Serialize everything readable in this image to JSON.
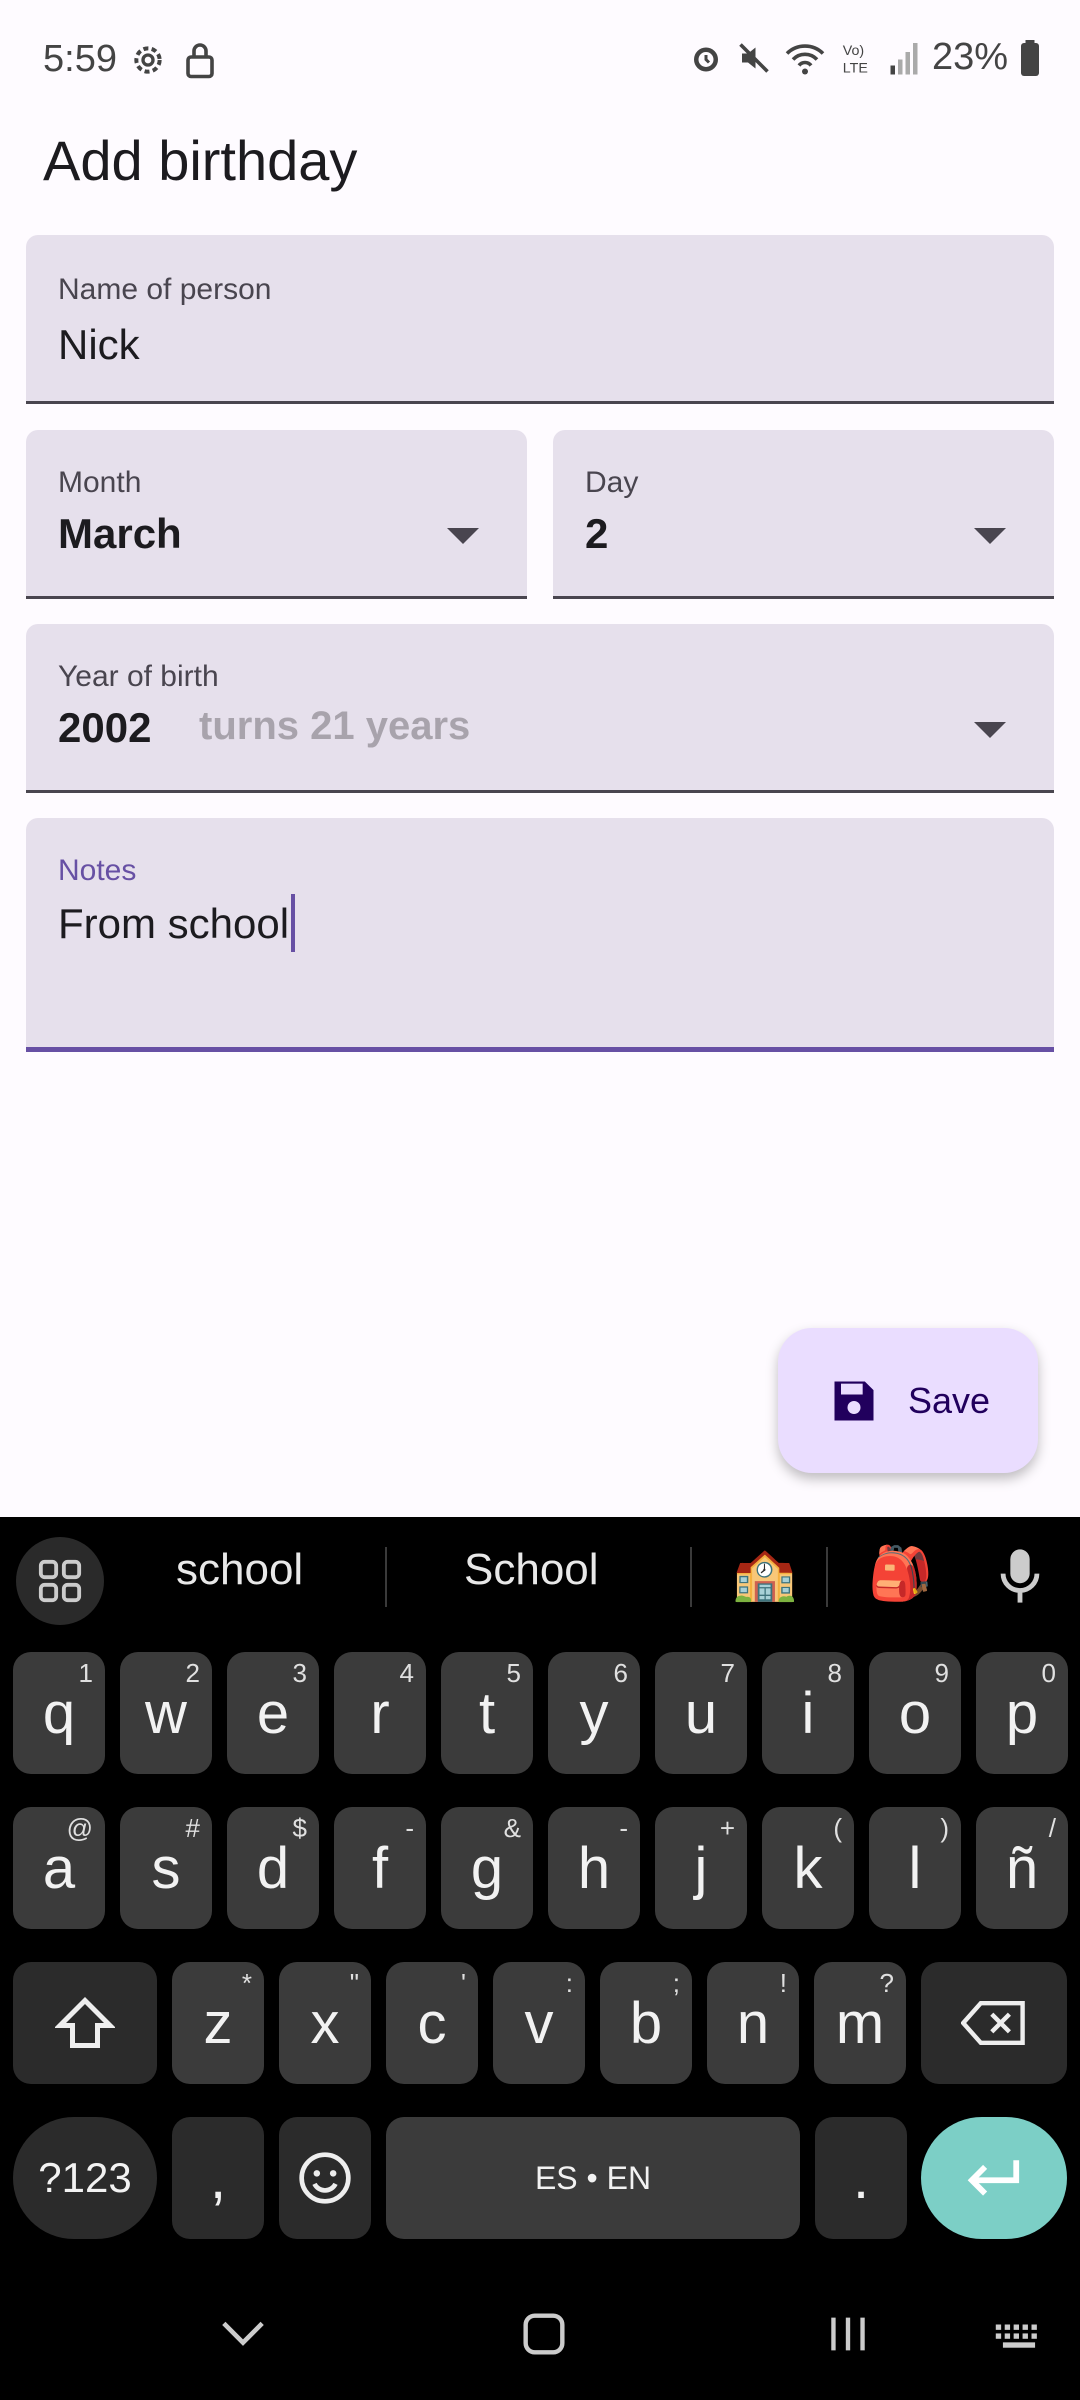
{
  "status_bar": {
    "time": "5:59",
    "battery": "23%"
  },
  "app_bar": {
    "title": "Add birthday"
  },
  "form": {
    "name": {
      "label": "Name of person",
      "value": "Nick"
    },
    "month": {
      "label": "Month",
      "value": "March"
    },
    "day": {
      "label": "Day",
      "value": "2"
    },
    "year": {
      "label": "Year of birth",
      "value": "2002",
      "hint": "turns 21 years"
    },
    "notes": {
      "label": "Notes",
      "value": "From school"
    }
  },
  "fab": {
    "label": "Save",
    "icon": "floppy-disk-icon"
  },
  "keyboard": {
    "suggestions": [
      "school",
      "School"
    ],
    "emoji_suggestions": [
      "🏫",
      "🎒"
    ],
    "row1": [
      [
        "q",
        "1"
      ],
      [
        "w",
        "2"
      ],
      [
        "e",
        "3"
      ],
      [
        "r",
        "4"
      ],
      [
        "t",
        "5"
      ],
      [
        "y",
        "6"
      ],
      [
        "u",
        "7"
      ],
      [
        "i",
        "8"
      ],
      [
        "o",
        "9"
      ],
      [
        "p",
        "0"
      ]
    ],
    "row2": [
      [
        "a",
        "@"
      ],
      [
        "s",
        "#"
      ],
      [
        "d",
        "$"
      ],
      [
        "f",
        "-"
      ],
      [
        "g",
        "&"
      ],
      [
        "h",
        "-"
      ],
      [
        "j",
        "+"
      ],
      [
        "k",
        "("
      ],
      [
        "l",
        ")"
      ],
      [
        "ñ",
        "/"
      ]
    ],
    "row3": [
      [
        "z",
        "*"
      ],
      [
        "x",
        "\""
      ],
      [
        "c",
        "'"
      ],
      [
        "v",
        ":"
      ],
      [
        "b",
        ";"
      ],
      [
        "n",
        "!"
      ],
      [
        "m",
        "?"
      ]
    ],
    "symbols_label": "?123",
    "comma": ",",
    "space_label": "ES • EN",
    "period": "."
  },
  "colors": {
    "accent": "#6750a4",
    "fab_bg": "#eaddff",
    "field_bg": "#e6e0ec",
    "enter_key": "#7ccfc6"
  }
}
